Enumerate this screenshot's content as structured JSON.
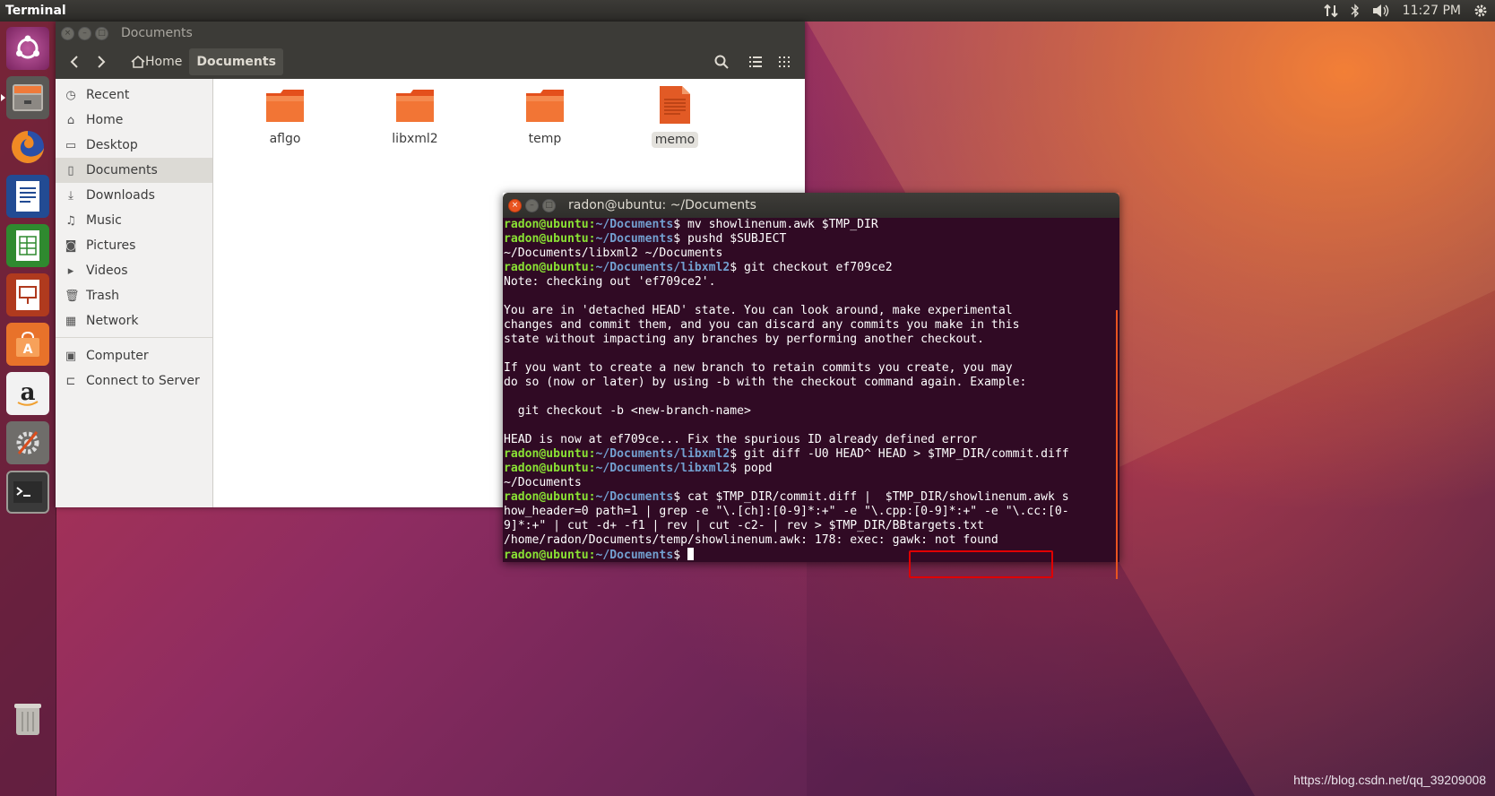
{
  "top_panel": {
    "app_title": "Terminal",
    "clock": "11:27 PM",
    "indicators": [
      "network-icon",
      "bluetooth-icon",
      "volume-icon",
      "settings-gear-icon"
    ]
  },
  "launcher": {
    "items": [
      "ubuntu-dash-icon",
      "files-icon",
      "firefox-icon",
      "writer-icon",
      "calc-icon",
      "impress-icon",
      "software-center-icon",
      "amazon-icon",
      "system-settings-icon",
      "terminal-icon"
    ],
    "trash": "trash-icon"
  },
  "file_manager": {
    "window_title": "Documents",
    "breadcrumb": {
      "home": "Home",
      "current": "Documents"
    },
    "sidebar": {
      "places": [
        {
          "icon": "clock-icon",
          "label": "Recent"
        },
        {
          "icon": "home-icon",
          "label": "Home"
        },
        {
          "icon": "folder-icon",
          "label": "Desktop"
        },
        {
          "icon": "document-icon",
          "label": "Documents",
          "selected": true
        },
        {
          "icon": "download-icon",
          "label": "Downloads"
        },
        {
          "icon": "music-icon",
          "label": "Music"
        },
        {
          "icon": "camera-icon",
          "label": "Pictures"
        },
        {
          "icon": "video-icon",
          "label": "Videos"
        },
        {
          "icon": "trash-icon",
          "label": "Trash"
        },
        {
          "icon": "network-icon",
          "label": "Network"
        }
      ],
      "devices": [
        {
          "icon": "computer-icon",
          "label": "Computer"
        },
        {
          "icon": "server-icon",
          "label": "Connect to Server"
        }
      ]
    },
    "files": [
      {
        "name": "aflgo",
        "type": "folder"
      },
      {
        "name": "libxml2",
        "type": "folder"
      },
      {
        "name": "temp",
        "type": "folder"
      },
      {
        "name": "memo",
        "type": "text-file",
        "highlighted": true
      }
    ]
  },
  "terminal": {
    "window_title": "radon@ubuntu: ~/Documents",
    "prompt_user": "radon@ubuntu",
    "lines": [
      {
        "path": "~/Documents",
        "cmd": " mv showlinenum.awk $TMP_DIR"
      },
      {
        "path": "~/Documents",
        "cmd": " pushd $SUBJECT"
      },
      {
        "text": "~/Documents/libxml2 ~/Documents"
      },
      {
        "path": "~/Documents/libxml2",
        "cmd": " git checkout ef709ce2"
      },
      {
        "text": "Note: checking out 'ef709ce2'."
      },
      {
        "text": ""
      },
      {
        "text": "You are in 'detached HEAD' state. You can look around, make experimental"
      },
      {
        "text": "changes and commit them, and you can discard any commits you make in this"
      },
      {
        "text": "state without impacting any branches by performing another checkout."
      },
      {
        "text": ""
      },
      {
        "text": "If you want to create a new branch to retain commits you create, you may"
      },
      {
        "text": "do so (now or later) by using -b with the checkout command again. Example:"
      },
      {
        "text": ""
      },
      {
        "text": "  git checkout -b <new-branch-name>"
      },
      {
        "text": ""
      },
      {
        "text": "HEAD is now at ef709ce... Fix the spurious ID already defined error"
      },
      {
        "path": "~/Documents/libxml2",
        "cmd": " git diff -U0 HEAD^ HEAD > $TMP_DIR/commit.diff"
      },
      {
        "path": "~/Documents/libxml2",
        "cmd": " popd"
      },
      {
        "text": "~/Documents"
      },
      {
        "path": "~/Documents",
        "cmd": " cat $TMP_DIR/commit.diff |  $TMP_DIR/showlinenum.awk s"
      },
      {
        "text": "how_header=0 path=1 | grep -e \"\\.[ch]:[0-9]*:+\" -e \"\\.cpp:[0-9]*:+\" -e \"\\.cc:[0-"
      },
      {
        "text": "9]*:+\" | cut -d+ -f1 | rev | cut -c2- | rev > $TMP_DIR/BBtargets.txt"
      },
      {
        "text": "/home/radon/Documents/temp/showlinenum.awk: 178: exec: gawk: not found"
      },
      {
        "path": "~/Documents",
        "cmd": " ",
        "cursor": true
      }
    ]
  },
  "watermark": "https://blog.csdn.net/qq_39209008"
}
